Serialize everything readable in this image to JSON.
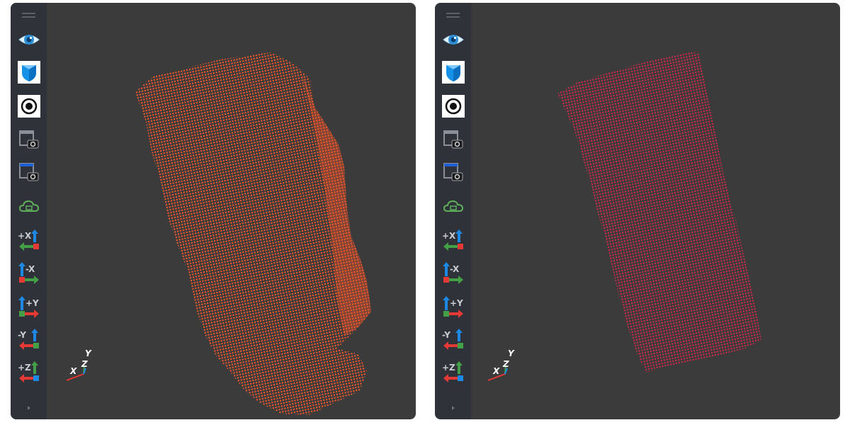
{
  "viewers": [
    {
      "id": "left",
      "point_color": "#ff5a2a",
      "point_color_dim": "#d8441d",
      "toolbar": {
        "buttons": [
          {
            "icon": "eye-icon"
          },
          {
            "icon": "shield-icon"
          },
          {
            "icon": "target-icon"
          },
          {
            "icon": "screenshot-icon"
          },
          {
            "icon": "screenshot-blue-icon"
          },
          {
            "icon": "cloud-icon"
          },
          {
            "icon": "view-plus-x-icon",
            "label": "+X"
          },
          {
            "icon": "view-minus-x-icon",
            "label": "-X"
          },
          {
            "icon": "view-plus-y-icon",
            "label": "+Y"
          },
          {
            "icon": "view-minus-y-icon",
            "label": "-Y"
          },
          {
            "icon": "view-plus-z-icon",
            "label": "+Z"
          }
        ]
      },
      "axes": {
        "x": "X",
        "y": "Y",
        "z": "Z"
      }
    },
    {
      "id": "right",
      "point_color": "#e0264d",
      "point_color_dim": "#b01c3c",
      "toolbar": {
        "buttons": [
          {
            "icon": "eye-icon"
          },
          {
            "icon": "shield-icon"
          },
          {
            "icon": "target-icon"
          },
          {
            "icon": "screenshot-icon"
          },
          {
            "icon": "screenshot-blue-icon"
          },
          {
            "icon": "cloud-icon"
          },
          {
            "icon": "view-plus-x-icon",
            "label": "+X"
          },
          {
            "icon": "view-minus-x-icon",
            "label": "-X"
          },
          {
            "icon": "view-plus-y-icon",
            "label": "+Y"
          },
          {
            "icon": "view-minus-y-icon",
            "label": "-Y"
          },
          {
            "icon": "view-plus-z-icon",
            "label": "+Z"
          }
        ]
      },
      "axes": {
        "x": "X",
        "y": "Y",
        "z": "Z"
      }
    }
  ],
  "colors": {
    "viewport_bg": "#3c3b3b",
    "toolbar_bg": "#2f3238",
    "axis_x": "#e53935",
    "axis_y": "#43a047",
    "axis_z": "#1e88e5"
  }
}
